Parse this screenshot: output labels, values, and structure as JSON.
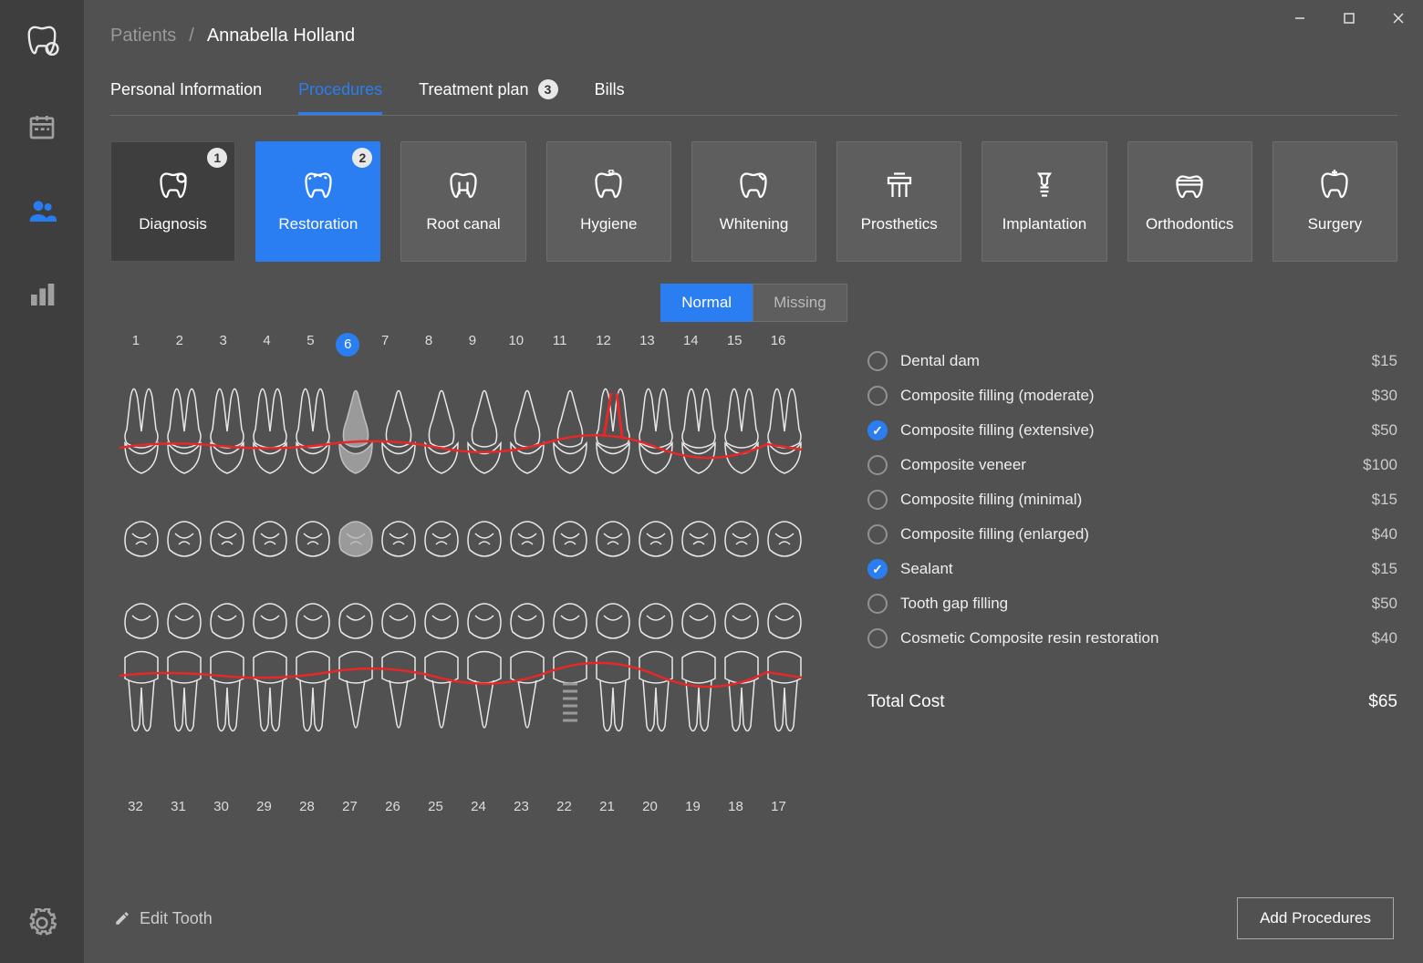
{
  "breadcrumb": {
    "root": "Patients",
    "current": "Annabella Holland"
  },
  "tabs": [
    {
      "label": "Personal  Information",
      "active": false,
      "badge": null
    },
    {
      "label": "Procedures",
      "active": true,
      "badge": null
    },
    {
      "label": "Treatment plan",
      "active": false,
      "badge": "3"
    },
    {
      "label": "Bills",
      "active": false,
      "badge": null
    }
  ],
  "categories": [
    {
      "label": "Diagnosis",
      "badge": "1",
      "style": "dark"
    },
    {
      "label": "Restoration",
      "badge": "2",
      "style": "selected"
    },
    {
      "label": "Root canal",
      "badge": null,
      "style": "normal"
    },
    {
      "label": "Hygiene",
      "badge": null,
      "style": "normal"
    },
    {
      "label": "Whitening",
      "badge": null,
      "style": "normal"
    },
    {
      "label": "Prosthetics",
      "badge": null,
      "style": "normal"
    },
    {
      "label": "Implantation",
      "badge": null,
      "style": "normal"
    },
    {
      "label": "Orthodontics",
      "badge": null,
      "style": "normal"
    },
    {
      "label": "Surgery",
      "badge": null,
      "style": "normal"
    }
  ],
  "segments": {
    "normal": "Normal",
    "missing": "Missing",
    "active": "normal"
  },
  "upper_numbers": [
    "1",
    "2",
    "3",
    "4",
    "5",
    "6",
    "7",
    "8",
    "9",
    "10",
    "11",
    "12",
    "13",
    "14",
    "15",
    "16"
  ],
  "lower_numbers": [
    "32",
    "31",
    "30",
    "29",
    "28",
    "27",
    "26",
    "25",
    "24",
    "23",
    "22",
    "21",
    "20",
    "19",
    "18",
    "17"
  ],
  "selected_tooth": "6",
  "options": [
    {
      "label": "Dental dam",
      "price": "$15",
      "checked": false
    },
    {
      "label": "Composite filling (moderate)",
      "price": "$30",
      "checked": false
    },
    {
      "label": "Composite filling (extensive)",
      "price": "$50",
      "checked": true
    },
    {
      "label": "Composite veneer",
      "price": "$100",
      "checked": false
    },
    {
      "label": "Composite filling (minimal)",
      "price": "$15",
      "checked": false
    },
    {
      "label": "Composite filling (enlarged)",
      "price": "$40",
      "checked": false
    },
    {
      "label": "Sealant",
      "price": "$15",
      "checked": true
    },
    {
      "label": "Tooth gap filling",
      "price": "$50",
      "checked": false
    },
    {
      "label": "Cosmetic Composite resin restoration",
      "price": "$40",
      "checked": false
    }
  ],
  "total": {
    "label": "Total Cost",
    "value": "$65"
  },
  "footer": {
    "edit": "Edit Tooth",
    "add": "Add Procedures"
  }
}
